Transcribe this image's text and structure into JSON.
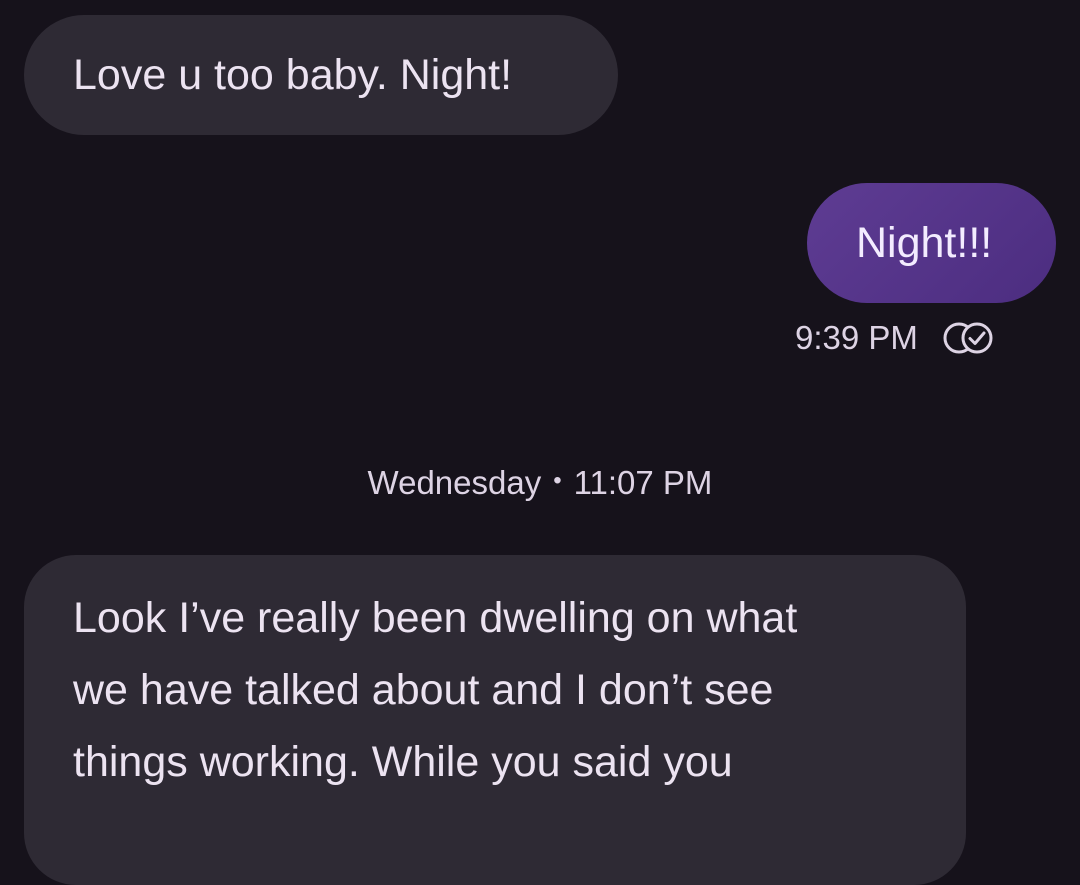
{
  "conversation": {
    "messages": [
      {
        "direction": "incoming",
        "text": "Love u too baby. Night!"
      },
      {
        "direction": "outgoing",
        "text": "Night!!!",
        "time": "9:39 PM",
        "status_icon": "read-receipt-icon"
      },
      {
        "direction": "incoming",
        "lines": [
          "Look I’ve really been dwelling on what",
          "we have talked about and I don’t see",
          "things working. While you said you"
        ]
      }
    ],
    "divider": {
      "day": "Wednesday",
      "separator": "•",
      "time": "11:07 PM"
    }
  },
  "colors": {
    "background": "#16121b",
    "incoming_bubble": "#2e2a34",
    "outgoing_bubble": "#5a3a8e",
    "text": "#ece3f1"
  }
}
